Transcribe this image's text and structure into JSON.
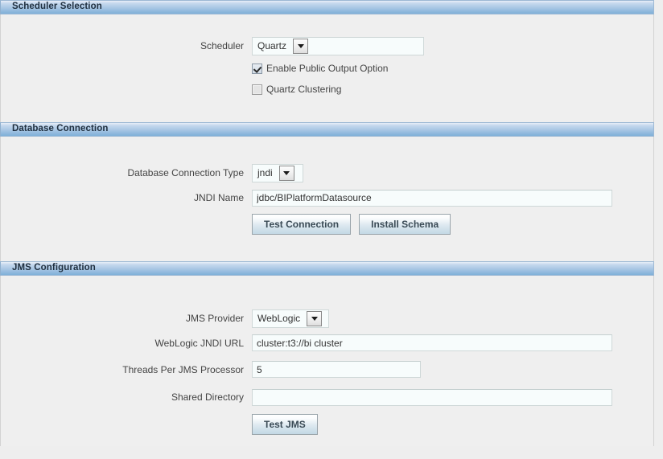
{
  "theme": {
    "header_gradient_top": "#e9eff8",
    "header_gradient_bottom": "#7fb0d8",
    "panel_bg": "#efefef",
    "page_bg": "#eeeeee",
    "input_bg": "#f7fcfc",
    "button_accent": "#c3d8e5",
    "text_color": "#333333"
  },
  "sections": {
    "scheduler": {
      "title": "Scheduler Selection",
      "scheduler_label": "Scheduler",
      "scheduler_value": "Quartz",
      "scheduler_options": [
        "Quartz"
      ],
      "enable_public_output_label": "Enable Public Output Option",
      "enable_public_output_checked": true,
      "quartz_clustering_label": "Quartz Clustering",
      "quartz_clustering_checked": false
    },
    "database": {
      "title": "Database Connection",
      "connection_type_label": "Database Connection Type",
      "connection_type_value": "jndi",
      "connection_type_options": [
        "jndi"
      ],
      "jndi_name_label": "JNDI Name",
      "jndi_name_value": "jdbc/BIPlatformDatasource",
      "jndi_name_placeholder": "",
      "test_connection_label": "Test Connection",
      "install_schema_label": "Install Schema"
    },
    "jms": {
      "title": "JMS Configuration",
      "provider_label": "JMS Provider",
      "provider_value": "WebLogic",
      "provider_options": [
        "WebLogic"
      ],
      "weblogic_jndi_url_label": "WebLogic JNDI URL",
      "weblogic_jndi_url_value": "cluster:t3://bi cluster",
      "weblogic_jndi_url_placeholder": "",
      "threads_label": "Threads Per JMS Processor",
      "threads_value": "5",
      "threads_placeholder": "",
      "shared_directory_label": "Shared Directory",
      "shared_directory_value": "",
      "shared_directory_placeholder": "",
      "test_jms_label": "Test JMS"
    }
  },
  "icons": {
    "dropdown": "chevron-down-icon",
    "checkbox_checked": "checkbox-checked-icon",
    "checkbox_unchecked": "checkbox-unchecked-icon"
  }
}
